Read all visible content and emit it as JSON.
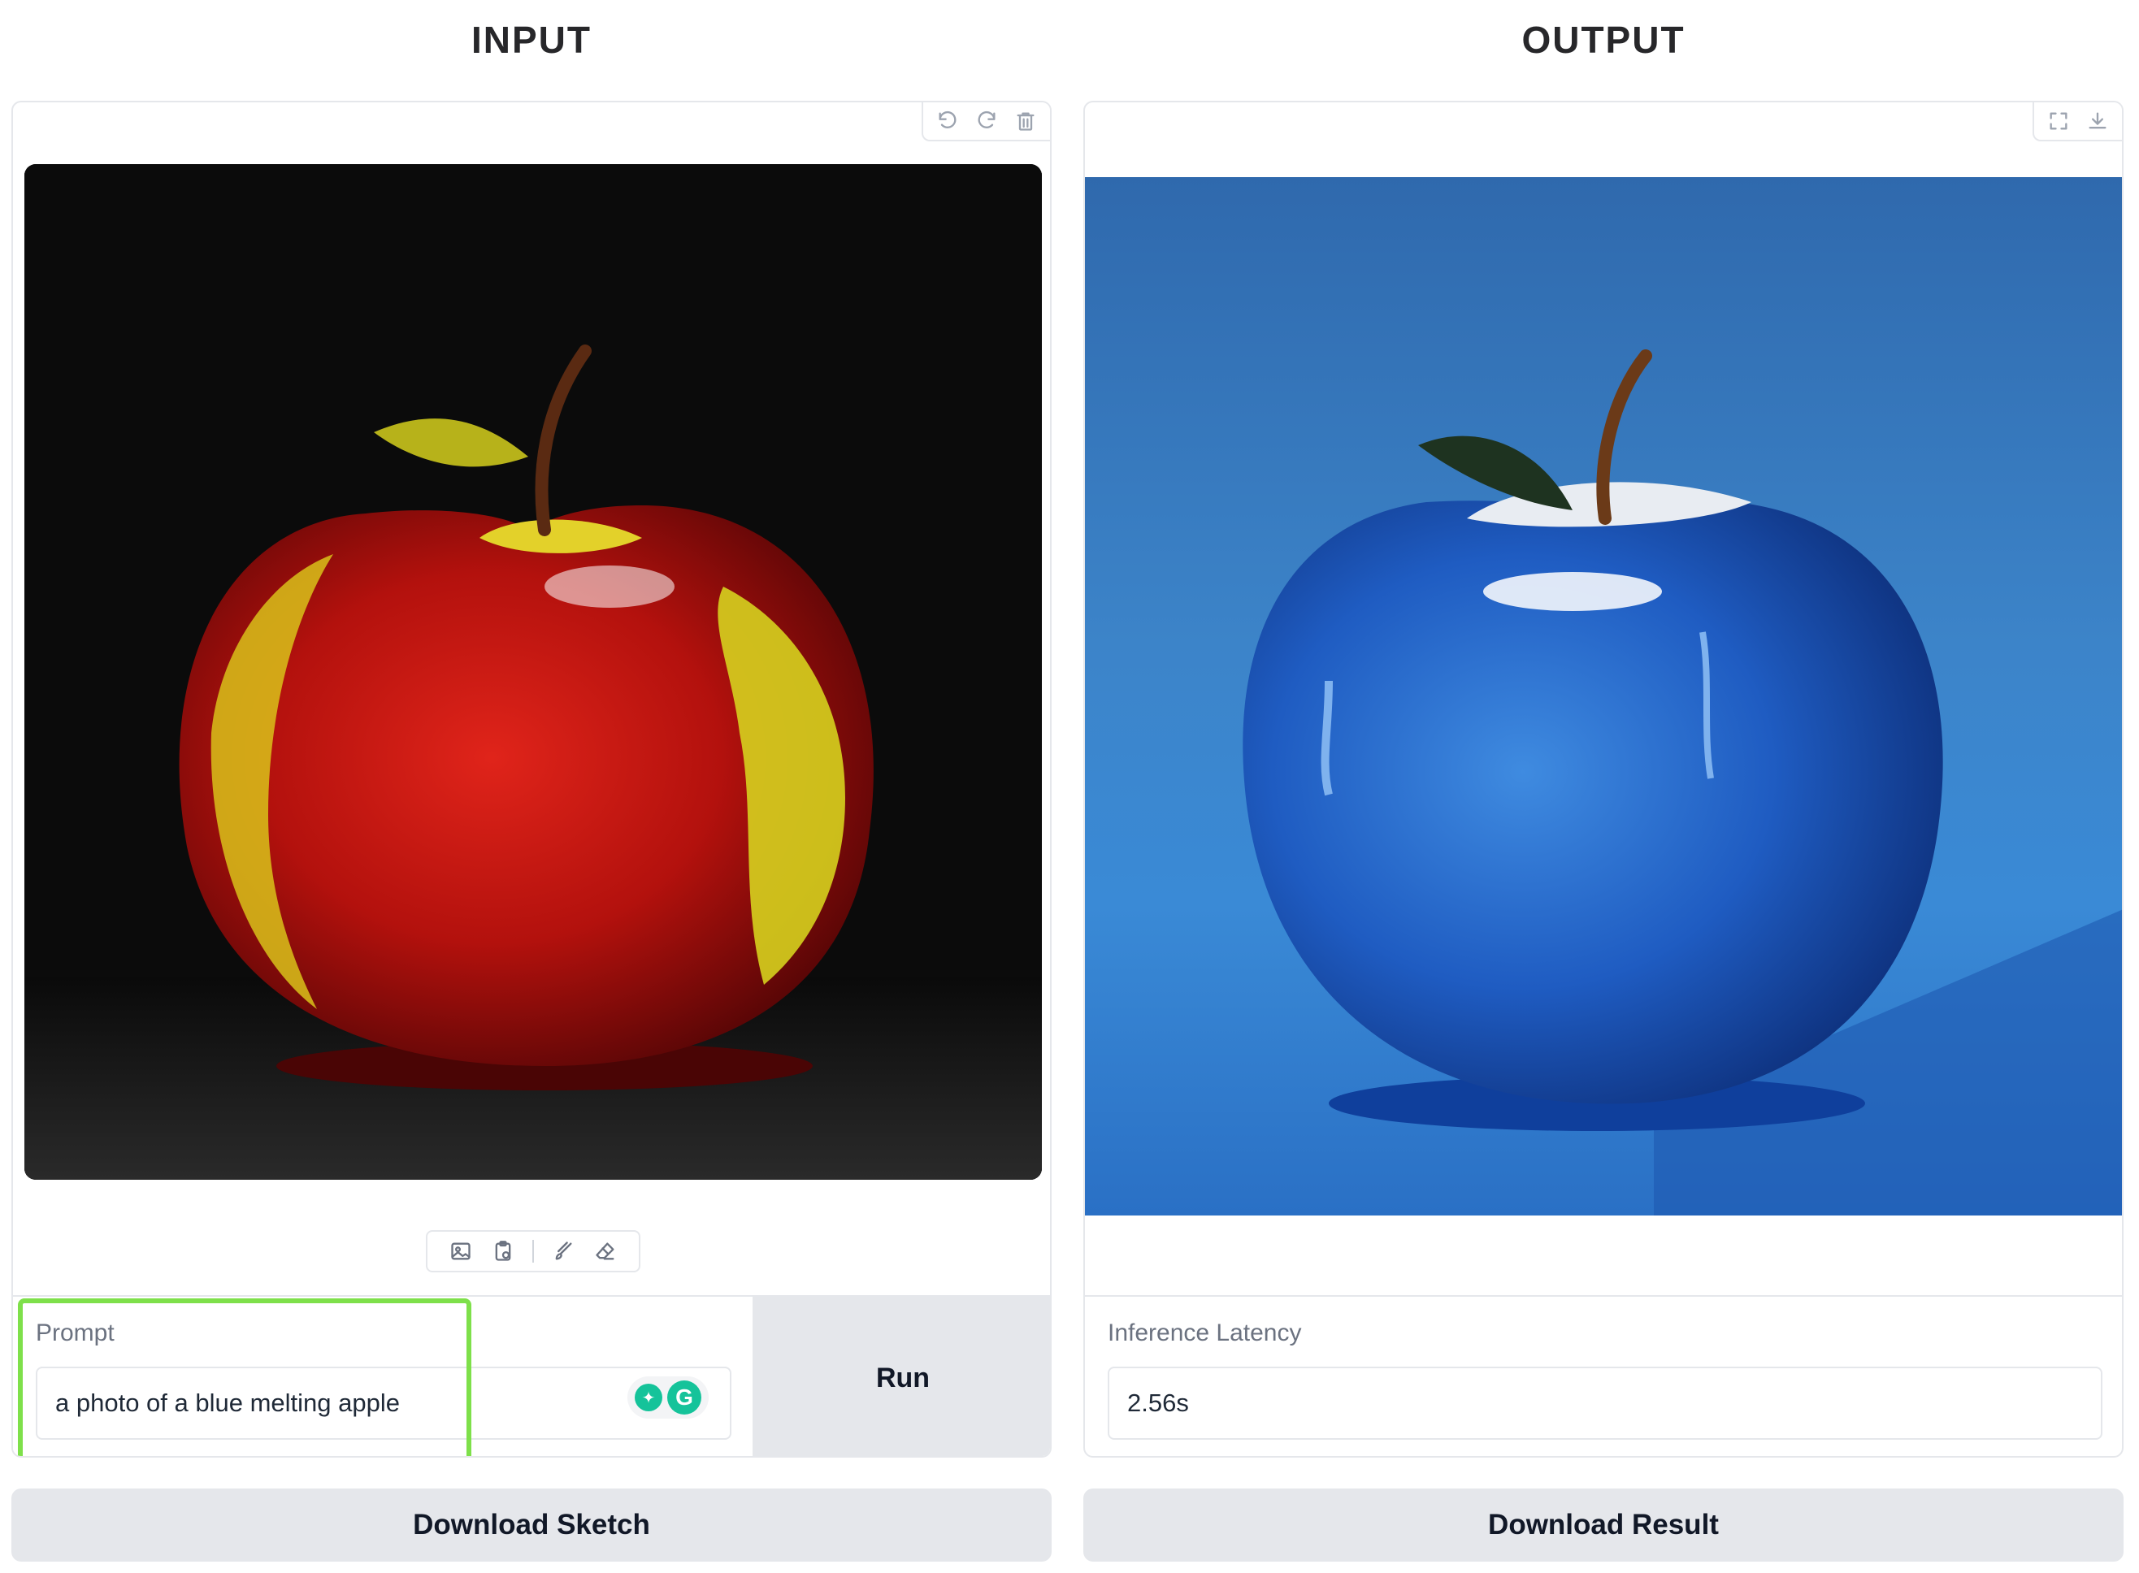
{
  "input": {
    "heading": "INPUT",
    "canvas_toolbar": {
      "icons": [
        "undo-icon",
        "redo-icon",
        "trash-icon"
      ]
    },
    "sketch_tools": {
      "icons": [
        "image-upload-icon",
        "clipboard-paste-icon",
        "brush-icon",
        "eraser-icon"
      ]
    },
    "prompt": {
      "label": "Prompt",
      "value": "a photo of a blue melting apple",
      "highlight_color": "#7ee04a"
    },
    "run_label": "Run",
    "download_label": "Download Sketch"
  },
  "output": {
    "heading": "OUTPUT",
    "image_toolbar": {
      "icons": [
        "fullscreen-icon",
        "download-icon"
      ]
    },
    "latency": {
      "label": "Inference Latency",
      "value": "2.56s"
    },
    "download_label": "Download Result"
  },
  "colors": {
    "button_bg": "#e5e7eb",
    "border": "#e5e7eb",
    "grammarly": "#15c39a"
  }
}
